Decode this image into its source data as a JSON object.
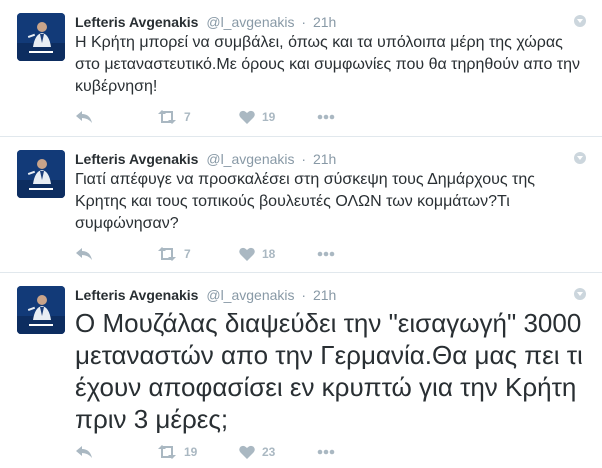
{
  "tweets": [
    {
      "fullname": "Lefteris Avgenakis",
      "username": "@l_avgenakis",
      "separator": "·",
      "time": "21h",
      "text": "Η Κρήτη μπορεί να συμβάλει, όπως και τα υπόλοιπα μέρη της χώρας στο μεταναστευτικό.Με όρους και συμφωνίες που θα τηρηθούν απο την κυβέρνηση!",
      "retweets": "7",
      "likes": "19"
    },
    {
      "fullname": "Lefteris Avgenakis",
      "username": "@l_avgenakis",
      "separator": "·",
      "time": "21h",
      "text": "Γιατί απέφυγε να προσκαλέσει  στη σύσκεψη τους Δημάρχους της Κρητης και τους τοπικούς βουλευτές ΟΛΩΝ των κομμάτων?Τι συμφώνησαν?",
      "retweets": "7",
      "likes": "18"
    },
    {
      "fullname": "Lefteris Avgenakis",
      "username": "@l_avgenakis",
      "separator": "·",
      "time": "21h",
      "text": "Ο Μουζάλας διαψεύδει την \"εισαγωγή\" 3000 μεταναστών απο την Γερμανία.Θα μας πει τι έχουν αποφασίσει εν κρυπτώ για την Κρήτη πριν 3 μέρες;",
      "retweets": "19",
      "likes": "23"
    }
  ],
  "icons": {
    "reply": "reply-icon",
    "retweet": "retweet-icon",
    "like": "heart-icon",
    "more": "more-icon",
    "caret": "caret-down-icon"
  },
  "colors": {
    "action_gray": "#aab8c2",
    "meta_gray": "#8899a6",
    "text": "#292f33",
    "avatar_bg": "#123a78"
  }
}
